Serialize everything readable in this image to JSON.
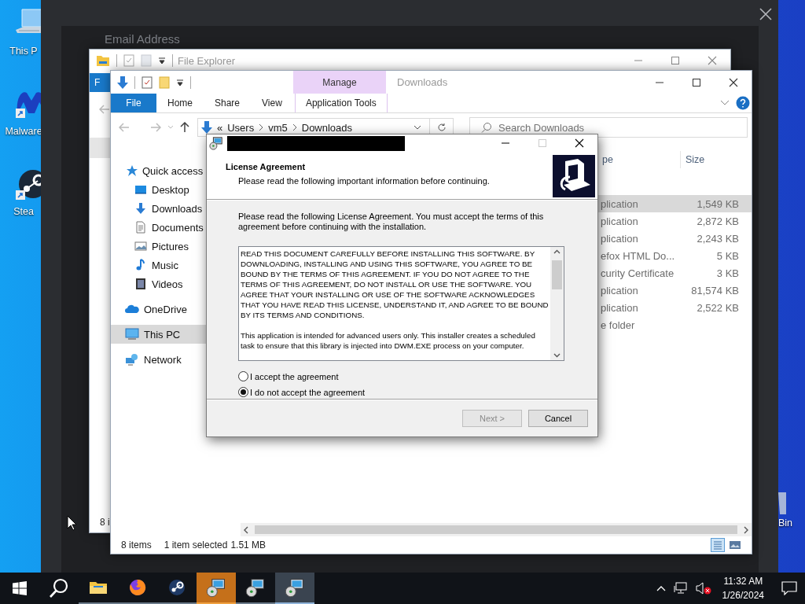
{
  "desktop": {
    "icons": [
      {
        "label": "This P",
        "kind": "computer"
      },
      {
        "label": "Malware",
        "kind": "m-logo"
      },
      {
        "label": "Stea",
        "kind": "steam"
      }
    ],
    "right_icon": {
      "label": "Bin"
    }
  },
  "overlay": {
    "field_label": "Email Address"
  },
  "back_window": {
    "title": "File Explorer",
    "tab": "F",
    "status": "8 i"
  },
  "explorer": {
    "title": "Downloads",
    "context_group": "Manage",
    "context_tab": "Application Tools",
    "tabs": [
      {
        "label": "File",
        "selected": true
      },
      {
        "label": "Home",
        "selected": false
      },
      {
        "label": "Share",
        "selected": false
      },
      {
        "label": "View",
        "selected": false
      }
    ],
    "address": {
      "overflow": "«",
      "crumbs": [
        "Users",
        "vm5",
        "Downloads"
      ]
    },
    "search": {
      "placeholder": "Search Downloads"
    },
    "nav": [
      {
        "label": "Quick access",
        "selected": false,
        "children": [
          {
            "label": "Desktop",
            "selected": false
          },
          {
            "label": "Downloads",
            "selected": false
          },
          {
            "label": "Documents",
            "selected": false
          },
          {
            "label": "Pictures",
            "selected": false
          },
          {
            "label": "Music",
            "selected": false
          },
          {
            "label": "Videos",
            "selected": false
          }
        ]
      },
      {
        "label": "OneDrive",
        "selected": false
      },
      {
        "label": "This PC",
        "selected": true
      },
      {
        "label": "Network",
        "selected": false
      }
    ],
    "columns": [
      "pe",
      "Size"
    ],
    "rows": [
      {
        "type": "plication",
        "size": "1,549 KB",
        "selected": true
      },
      {
        "type": "plication",
        "size": "2,872 KB",
        "selected": false
      },
      {
        "type": "plication",
        "size": "2,243 KB",
        "selected": false
      },
      {
        "type": "efox HTML Do...",
        "size": "5 KB",
        "selected": false
      },
      {
        "type": "curity Certificate",
        "size": "3 KB",
        "selected": false
      },
      {
        "type": "plication",
        "size": "81,574 KB",
        "selected": false
      },
      {
        "type": "plication",
        "size": "2,522 KB",
        "selected": false
      },
      {
        "type": "e folder",
        "selected": false
      }
    ],
    "status": {
      "count": "8 items",
      "selection": "1 item selected",
      "size": "1.51 MB"
    }
  },
  "dialog": {
    "heading": "License Agreement",
    "subheading": "Please read the following important information before continuing.",
    "intro": "Please read the following License Agreement. You must accept the terms of this agreement before continuing with the installation.",
    "license": [
      "READ THIS DOCUMENT CAREFULLY BEFORE INSTALLING THIS SOFTWARE. BY DOWNLOADING, INSTALLING AND USING THIS SOFTWARE, YOU AGREE TO BE BOUND BY THE TERMS OF THIS AGREEMENT. IF YOU DO NOT AGREE TO THE TERMS OF THIS AGREEMENT, DO NOT INSTALL OR USE THE SOFTWARE. YOU AGREE THAT YOUR INSTALLING OR USE OF THE SOFTWARE ACKNOWLEDGES THAT YOU HAVE READ THIS LICENSE, UNDERSTAND IT, AND AGREE TO BE BOUND BY ITS TERMS AND CONDITIONS.",
      "This application is intended for advanced users only. This installer creates a scheduled task to ensure that this library is injected into DWM.EXE process on your computer."
    ],
    "options": [
      {
        "label": "I accept the agreement",
        "selected": false
      },
      {
        "label": "I do not accept the agreement",
        "selected": true
      }
    ],
    "buttons": [
      {
        "label": "Next >",
        "disabled": true
      },
      {
        "label": "Cancel",
        "disabled": false
      }
    ]
  },
  "taskbar": {
    "apps": [
      {
        "kind": "explorer",
        "flashing": false,
        "selected": false
      },
      {
        "kind": "browser",
        "flashing": false,
        "selected": false
      },
      {
        "kind": "steam",
        "flashing": false,
        "selected": false
      },
      {
        "kind": "installer",
        "flashing": true,
        "selected": false
      },
      {
        "kind": "installer",
        "flashing": false,
        "selected": false
      },
      {
        "kind": "installer",
        "flashing": false,
        "selected": true
      }
    ],
    "time": "11:32 AM",
    "date": "1/26/2024"
  }
}
